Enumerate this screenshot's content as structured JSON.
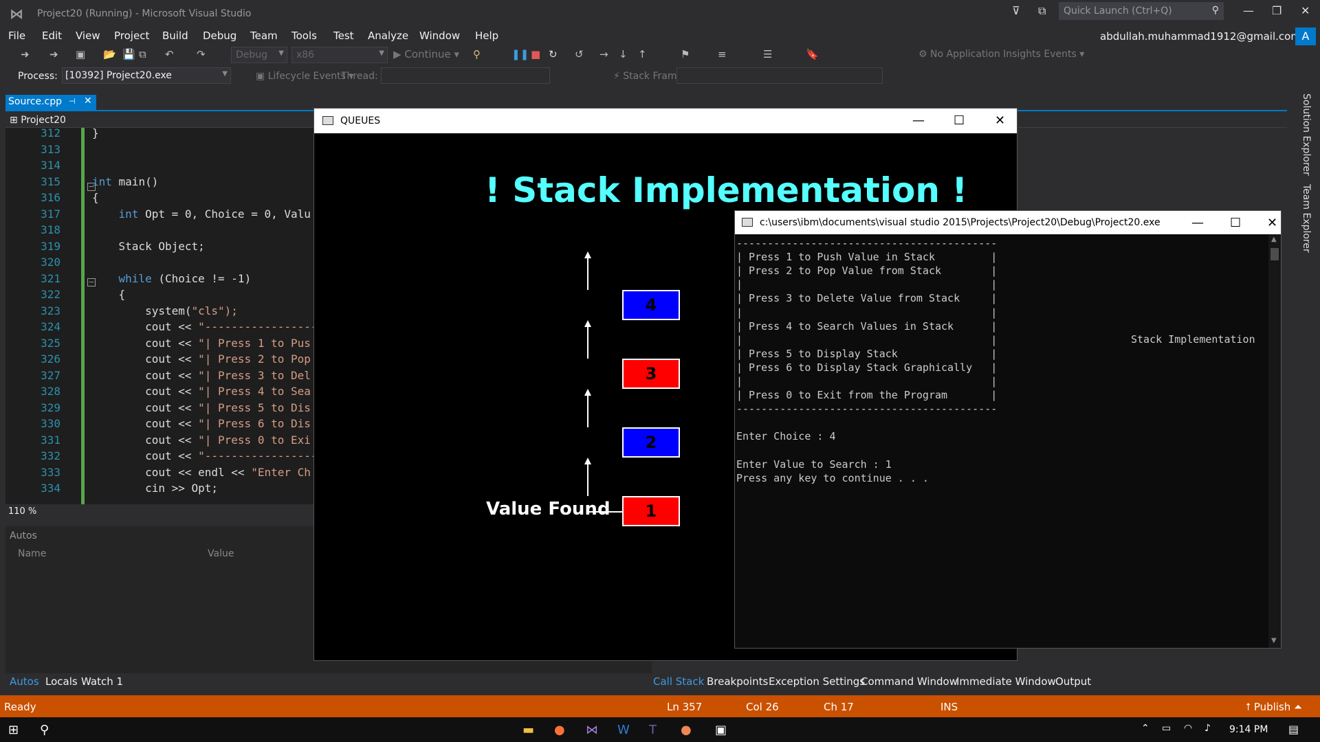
{
  "vs": {
    "title": "Project20 (Running) - Microsoft Visual Studio",
    "quick_launch_placeholder": "Quick Launch (Ctrl+Q)",
    "account": "abdullah.muhammad1912@gmail.com",
    "avatar": "A",
    "menu": [
      "File",
      "Edit",
      "View",
      "Project",
      "Build",
      "Debug",
      "Team",
      "Tools",
      "Test",
      "Analyze",
      "Window",
      "Help"
    ]
  },
  "toolbar": {
    "config": "Debug",
    "platform": "x86",
    "continue": "Continue",
    "insights": "No Application Insights Events",
    "process_label": "Process:",
    "process_value": "[10392] Project20.exe",
    "lifecycle": "Lifecycle Events",
    "thread_label": "Thread:",
    "stack_frame_label": "Stack Frame:"
  },
  "editor": {
    "tab": "Source.cpp",
    "project": "Project20",
    "zoom": "110 %",
    "lines": [
      {
        "n": "312",
        "code": "}"
      },
      {
        "n": "313",
        "code": ""
      },
      {
        "n": "314",
        "code": ""
      },
      {
        "n": "315",
        "code": "int main()"
      },
      {
        "n": "316",
        "code": "{"
      },
      {
        "n": "317",
        "code": "    int Opt = 0, Choice = 0, Valu"
      },
      {
        "n": "318",
        "code": ""
      },
      {
        "n": "319",
        "code": "    Stack Object;"
      },
      {
        "n": "320",
        "code": ""
      },
      {
        "n": "321",
        "code": "    while (Choice != -1)"
      },
      {
        "n": "322",
        "code": "    {"
      },
      {
        "n": "323",
        "code": "        system(\"cls\");"
      },
      {
        "n": "324",
        "code": "        cout << \"-----------------"
      },
      {
        "n": "325",
        "code": "        cout << \"| Press 1 to Pus"
      },
      {
        "n": "326",
        "code": "        cout << \"| Press 2 to Pop"
      },
      {
        "n": "327",
        "code": "        cout << \"| Press 3 to Del"
      },
      {
        "n": "328",
        "code": "        cout << \"| Press 4 to Sea"
      },
      {
        "n": "329",
        "code": "        cout << \"| Press 5 to Dis"
      },
      {
        "n": "330",
        "code": "        cout << \"| Press 6 to Dis"
      },
      {
        "n": "331",
        "code": "        cout << \"| Press 0 to Exi"
      },
      {
        "n": "332",
        "code": "        cout << \"-----------------"
      },
      {
        "n": "333",
        "code": "        cout << endl << \"Enter Ch"
      },
      {
        "n": "334",
        "code": "        cin >> Opt;"
      }
    ]
  },
  "autos": {
    "title": "Autos",
    "col_name": "Name",
    "col_value": "Value"
  },
  "bottom_tabs_left": [
    "Autos",
    "Locals",
    "Watch 1"
  ],
  "bottom_tabs_right": [
    "Call Stack",
    "Breakpoints",
    "Exception Settings",
    "Command Window",
    "Immediate Window",
    "Output"
  ],
  "status": {
    "ready": "Ready",
    "ln": "Ln 357",
    "col": "Col 26",
    "ch": "Ch 17",
    "ins": "INS",
    "publish": "Publish"
  },
  "right_rail": [
    "Solution Explorer",
    "Team Explorer"
  ],
  "queues": {
    "title": "QUEUES",
    "heading": "! Stack Implementation !",
    "nodes": [
      "4",
      "3",
      "2",
      "1"
    ],
    "value_found": "Value Found"
  },
  "console": {
    "title": "c:\\users\\ibm\\documents\\visual studio 2015\\Projects\\Project20\\Debug\\Project20.exe",
    "lines": [
      "------------------------------------------",
      "| Press 1 to Push Value in Stack         |",
      "| Press 2 to Pop Value from Stack        |",
      "|                                        |",
      "| Press 3 to Delete Value from Stack     |",
      "|                                        |",
      "| Press 4 to Search Values in Stack      |",
      "|                                        |",
      "| Press 5 to Display Stack               |",
      "| Press 6 to Display Stack Graphically   |",
      "|                                        |",
      "| Press 0 to Exit from the Program       |",
      "------------------------------------------",
      "",
      "Enter Choice : 4",
      "",
      "Enter Value to Search : 1",
      "Press any key to continue . . ."
    ],
    "right_text": "Stack Implementation"
  },
  "taskbar": {
    "time": "9:14 PM"
  },
  "colors": {
    "accent": "#007acc",
    "status": "#ca5100",
    "node_red": "#ff0000",
    "node_blue": "#0000ff",
    "heading": "#55ffff"
  }
}
